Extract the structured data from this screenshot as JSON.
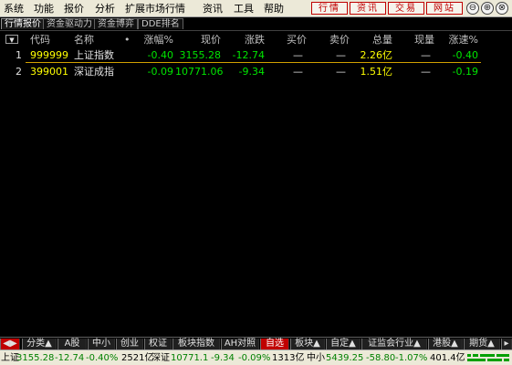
{
  "menu": [
    "系统",
    "功能",
    "报价",
    "分析",
    "扩展市场行情",
    "资讯",
    "工具",
    "帮助"
  ],
  "quick_buttons": [
    "行情",
    "资讯",
    "交易",
    "网站"
  ],
  "window_buttons": [
    "⊖",
    "⊕",
    "⊗"
  ],
  "tabs": [
    "行情报价",
    "资金驱动力",
    "资金博弈",
    "DDE排名"
  ],
  "columns": [
    "代码",
    "名称",
    "•",
    "涨幅%",
    "现价",
    "涨跌",
    "买价",
    "卖价",
    "总量",
    "现量",
    "涨速%"
  ],
  "sort_glyph": "▼",
  "rows": [
    {
      "idx": "1",
      "code": "999999",
      "name": "上证指数",
      "chg_pct": "-0.40",
      "price": "3155.28",
      "change": "-12.74",
      "bid": "—",
      "ask": "—",
      "volume": "2.26亿",
      "cur_vol": "—",
      "speed": "-0.40"
    },
    {
      "idx": "2",
      "code": "399001",
      "name": "深证成指",
      "chg_pct": "-0.09",
      "price": "10771.06",
      "change": "-9.34",
      "bid": "—",
      "ask": "—",
      "volume": "1.51亿",
      "cur_vol": "—",
      "speed": "-0.19"
    }
  ],
  "category_tabs": [
    "分类▲",
    "A股",
    "中小",
    "创业",
    "权证",
    "板块指数",
    "AH对照",
    "自选",
    "板块▲",
    "自定▲",
    "证监会行业▲",
    "港股▲",
    "期货▲"
  ],
  "status": {
    "sh_label": "上证",
    "sh_price": "3155.28",
    "sh_change": "-12.74",
    "sh_pct": "-0.40%",
    "sh_amount": "2521亿",
    "sz_label": "深证",
    "sz_price": "10771.1",
    "sz_change": "-9.34",
    "sz_pct": "-0.09%",
    "sz_amount": "1313亿",
    "zx_label": "中小",
    "zx_price": "5439.25",
    "zx_change": "-58.80",
    "zx_pct": "-1.07%",
    "zx_amount": "401.4亿"
  },
  "colors": {
    "up": "#ff0000",
    "down": "#00e600",
    "code": "#ffff00",
    "active_tab": "#c00000"
  }
}
